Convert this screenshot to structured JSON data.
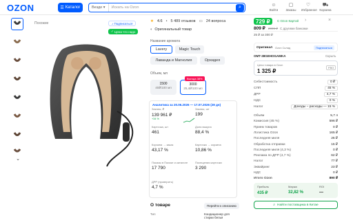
{
  "header": {
    "logo": "OZON",
    "catalog": "Каталог",
    "search_filter": "Везде",
    "search_placeholder": "Искать на Ozon",
    "icons": [
      {
        "label": "Войти",
        "icon": "user-icon"
      },
      {
        "label": "Заказы",
        "icon": "box-icon"
      },
      {
        "label": "Избранное",
        "icon": "heart-icon"
      },
      {
        "label": "Корзина",
        "icon": "cart-icon"
      }
    ]
  },
  "product": {
    "title": "Похожие",
    "badge_subscribe": "Подписаться",
    "badge_price": "Цена что надо",
    "rating": "4.6",
    "reviews": "5 489 отзывов",
    "questions": "24 вопроса",
    "original": "Оригинальный товар"
  },
  "aroma": {
    "label": "Название аромата",
    "options": [
      "Lavery",
      "Magic Touch",
      "Лаванда и Магнолия",
      "Орхидея"
    ]
  },
  "volume": {
    "label": "Объем, мл",
    "options": [
      {
        "v": "1500",
        "p": "40₽/100 мл"
      },
      {
        "v": "3000",
        "p": "25,4₽/100 мл",
        "badge": "Выгода 38%"
      }
    ]
  },
  "analytics": {
    "title": "Аналитика за 20.06.2026 — 17.07.2026 (28 дн)",
    "cells": [
      {
        "label": "Заказы, ₽",
        "value": "139 961 ₽",
        "sub": "+34 %"
      },
      {
        "label": "Заказы, шт",
        "value": "199",
        "sub": ""
      },
      {
        "label": "Карточка, шт",
        "value": "461",
        "sub": ""
      },
      {
        "label": "Доля выкупа",
        "value": "88,4 %",
        "sub": ""
      },
      {
        "label": "Корзина → заказ",
        "value": "43,17 %",
        "sub": ""
      },
      {
        "label": "Карточка → корзина",
        "value": "10,86 %",
        "sub": ""
      },
      {
        "label": "Показы в Поиске и каталоге",
        "value": "17 790",
        "sub": ""
      },
      {
        "label": "Посещения карточки",
        "value": "3 290",
        "sub": ""
      },
      {
        "label": "ДРР (проверить)",
        "value": "4,7 %",
        "sub": ""
      }
    ]
  },
  "about": {
    "title": "О товаре",
    "link": "Перейти к описанию",
    "rows": [
      {
        "k": "Тип",
        "v": "Кондиционер для стирки белья"
      }
    ]
  },
  "price": {
    "card": "729 ₽",
    "card_note": "С Ozon Картой",
    "regular": "809 ₽",
    "old": "2999 ₽",
    "regular_note": "С другими банками",
    "installment": "25 ₽ за 300 ₽"
  },
  "seller": {
    "name": "Оригинал",
    "tag": "Ozon Склад",
    "action": "Подписаться",
    "sku": "OMT-38GEHOGAMKA",
    "hide": "Скрыть"
  },
  "calc": {
    "label": "Цена товара в Ozon",
    "value": "1 325 ₽",
    "fbo": "FBO"
  },
  "metrics": [
    {
      "k": "Себестоимость",
      "v": "0 ₽"
    },
    {
      "k": "СПП",
      "v": "45 %"
    },
    {
      "k": "ДРР",
      "v": "4,7 %"
    },
    {
      "k": "НДС",
      "v": "0 %"
    },
    {
      "k": "Налог",
      "v": "Доходы − расходы — 15 %"
    },
    {
      "k": "Объём",
      "v": "5,7 л"
    },
    {
      "k": "Комиссия (45 %)",
      "v": "596 ₽"
    },
    {
      "k": "Прием товаров",
      "v": "0 ₽"
    },
    {
      "k": "Логистика Ozon",
      "v": "165 ₽"
    },
    {
      "k": "Последняя миля",
      "v": "25 ₽"
    },
    {
      "k": "Обработка отправки",
      "v": "15 ₽"
    },
    {
      "k": "Последняя миля (4,3 %)",
      "v": "0 ₽"
    },
    {
      "k": "Реклама по ДРР (4,7 %)",
      "v": "62 ₽"
    },
    {
      "k": "Налог",
      "v": "77 ₽"
    },
    {
      "k": "Эквайринг",
      "v": "23 ₽"
    },
    {
      "k": "НДС",
      "v": "0 ₽"
    },
    {
      "k": "Итого Ozon",
      "v": "890 ₽"
    }
  ],
  "profit": {
    "label1": "Прибыль",
    "value1": "435 ₽",
    "label2": "Маржа",
    "value2": "32,82 %",
    "label3": "ROI",
    "value3": "—"
  },
  "find_btn": "Найти поставщика в Китае"
}
